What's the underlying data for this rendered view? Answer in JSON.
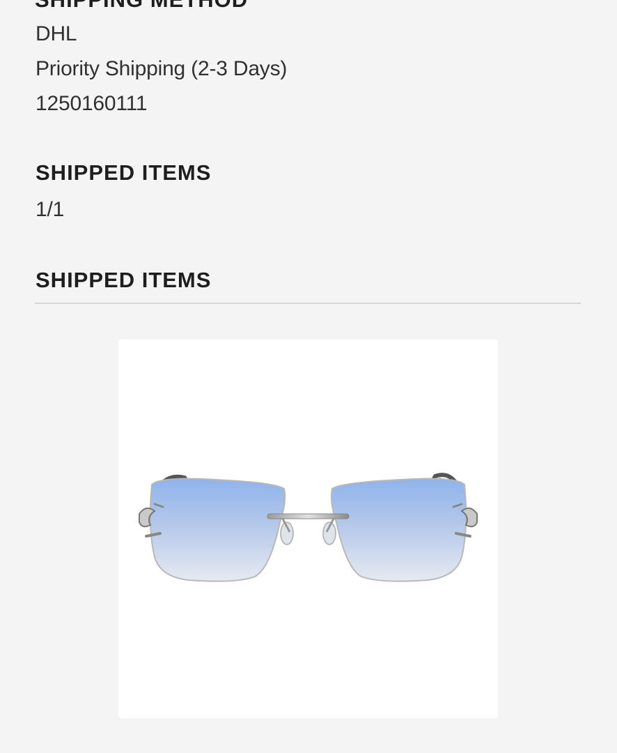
{
  "shipping": {
    "heading": "SHIPPING METHOD",
    "carrier": "DHL",
    "service": "Priority Shipping (2-3 Days)",
    "tracking_number": "1250160111"
  },
  "shipped_count": {
    "heading": "SHIPPED ITEMS",
    "value": "1/1"
  },
  "shipped_items": {
    "heading": "SHIPPED ITEMS",
    "items": [
      {
        "image": "rimless-blue-tinted-sunglasses"
      }
    ]
  },
  "colors": {
    "background": "#f4f4f4",
    "card": "#ffffff",
    "text": "#2b2b2b",
    "divider": "#d6d6d6",
    "lens_tint": "#9fbfe8",
    "temple_accent": "#2c4fc0"
  }
}
